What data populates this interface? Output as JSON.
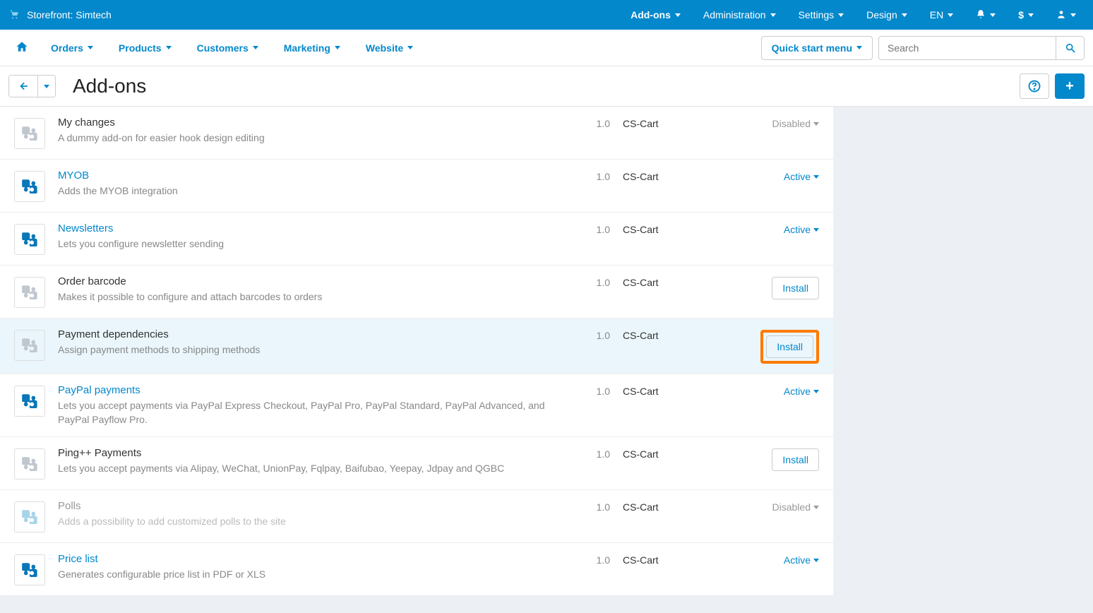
{
  "topbar": {
    "storefront_label": "Storefront: Simtech",
    "menu": [
      "Add-ons",
      "Administration",
      "Settings",
      "Design",
      "EN"
    ],
    "currency_symbol": "$"
  },
  "mainnav": {
    "items": [
      "Orders",
      "Products",
      "Customers",
      "Marketing",
      "Website"
    ],
    "quickstart_label": "Quick start menu",
    "search_placeholder": "Search"
  },
  "page": {
    "title": "Add-ons"
  },
  "labels": {
    "install": "Install",
    "active": "Active",
    "disabled": "Disabled"
  },
  "addons": [
    {
      "name": "My changes",
      "desc": "A dummy add-on for easier hook design editing",
      "version": "1.0",
      "developer": "CS-Cart",
      "state": "disabled_gray",
      "icon": "gray"
    },
    {
      "name": "MYOB",
      "desc": "Adds the MYOB integration",
      "version": "1.0",
      "developer": "CS-Cart",
      "state": "active",
      "icon": "blue"
    },
    {
      "name": "Newsletters",
      "desc": "Lets you configure newsletter sending",
      "version": "1.0",
      "developer": "CS-Cart",
      "state": "active",
      "icon": "blue"
    },
    {
      "name": "Order barcode",
      "desc": "Makes it possible to configure and attach barcodes to orders",
      "version": "1.0",
      "developer": "CS-Cart",
      "state": "install",
      "icon": "gray"
    },
    {
      "name": "Payment dependencies",
      "desc": "Assign payment methods to shipping methods",
      "version": "1.0",
      "developer": "CS-Cart",
      "state": "install_highlight",
      "icon": "gray"
    },
    {
      "name": "PayPal payments",
      "desc": "Lets you accept payments via PayPal Express Checkout, PayPal Pro, PayPal Standard, PayPal Advanced, and PayPal Payflow Pro.",
      "version": "1.0",
      "developer": "CS-Cart",
      "state": "active",
      "icon": "blue"
    },
    {
      "name": "Ping++ Payments",
      "desc": "Lets you accept payments via Alipay, WeChat, UnionPay, Fqlpay, Baifubao, Yeepay, Jdpay and QGBC",
      "version": "1.0",
      "developer": "CS-Cart",
      "state": "install",
      "icon": "gray"
    },
    {
      "name": "Polls",
      "desc": "Adds a possibility to add customized polls to the site",
      "version": "1.0",
      "developer": "CS-Cart",
      "state": "disabled_muted",
      "icon": "light"
    },
    {
      "name": "Price list",
      "desc": "Generates configurable price list in PDF or XLS",
      "version": "1.0",
      "developer": "CS-Cart",
      "state": "active",
      "icon": "blue"
    }
  ]
}
